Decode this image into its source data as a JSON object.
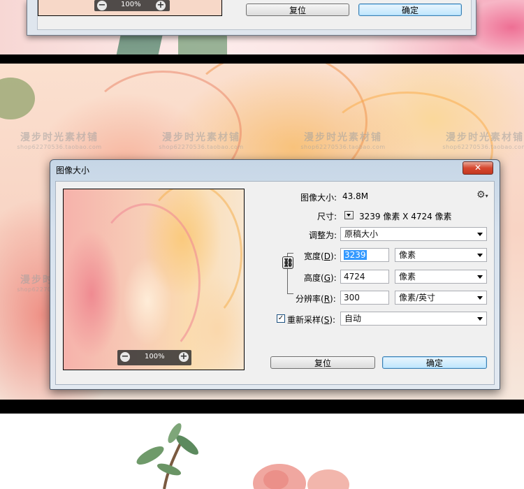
{
  "top_dialog": {
    "zoom_out": "−",
    "zoom_level": "100%",
    "zoom_in": "+",
    "reset_label": "复位",
    "ok_label": "确定"
  },
  "watermark": {
    "text": "漫步时光素材铺",
    "url": "shop62270536.taobao.com"
  },
  "dialog": {
    "title": "图像大小",
    "close_glyph": "✕",
    "image_size_label": "图像大小:",
    "image_size_value": "43.8M",
    "gear_icon": "⚙",
    "dimensions_label": "尺寸:",
    "dimensions_value": "3239 像素  X  4724 像素",
    "fit_to_label": "调整为:",
    "fit_to_value": "原稿大小",
    "width_label": "宽度(",
    "width_key": "D",
    "width_value": "3239",
    "width_unit": "像素",
    "height_label": "高度(",
    "height_key": "G",
    "height_value": "4724",
    "height_unit": "像素",
    "resolution_label": "分辨率(",
    "resolution_key": "R",
    "resolution_value": "300",
    "resolution_unit": "像素/英寸",
    "resample_label": "重新采样(",
    "resample_key": "S",
    "resample_checked": true,
    "resample_value": "自动",
    "close_paren": "):",
    "link_icon": "chain-link",
    "zoom_out": "−",
    "zoom_level": "100%",
    "zoom_in": "+",
    "reset_label": "复位",
    "ok_label": "确定"
  }
}
